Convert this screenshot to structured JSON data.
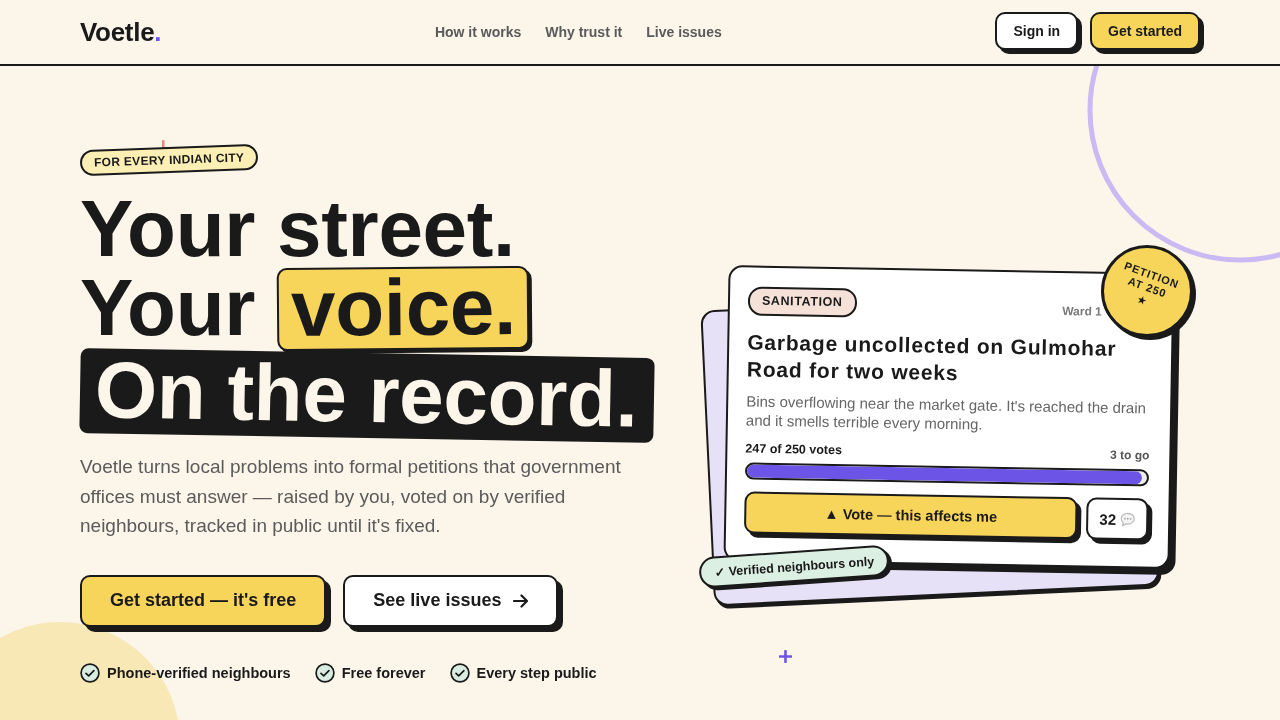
{
  "header": {
    "logo": {
      "name": "Voetle",
      "dot": "."
    },
    "nav": [
      {
        "label": "How it works"
      },
      {
        "label": "Why trust it"
      },
      {
        "label": "Live issues"
      }
    ],
    "buttons": [
      {
        "label": "Sign in",
        "kind": "secondary"
      },
      {
        "label": "Get started",
        "kind": "primary"
      }
    ]
  },
  "hero": {
    "badge": "FOR EVERY INDIAN CITY",
    "headline": [
      [
        {
          "text": "Your street.",
          "kind": "plain"
        }
      ],
      [
        {
          "text": "Your",
          "kind": "plain"
        },
        {
          "text": "voice.",
          "kind": "highlight"
        }
      ],
      [
        {
          "text": "On the record.",
          "kind": "banner"
        }
      ]
    ],
    "description": "Voetle turns local problems into formal petitions that government offices must answer — raised by you, voted on by verified neighbours, tracked in public until it's fixed.",
    "buttons": [
      {
        "label": "Get started — it's free",
        "kind": "primary",
        "arrow": false
      },
      {
        "label": "See live issues",
        "kind": "secondary",
        "arrow": true
      }
    ],
    "features": [
      "Phone-verified neighbours",
      "Free forever",
      "Every step public"
    ]
  },
  "issue_card": {
    "category": "SANITATION",
    "ward": "Ward 1",
    "title": "Garbage uncollected on Gulmohar Road for two weeks",
    "description": "Bins overflowing near the market gate. It's reached the drain and it smells terrible every morning.",
    "votes": "247 of 250 votes",
    "remaining": "3 to go",
    "level": 0.988,
    "vote_button": "▲ Vote — this affects me",
    "comments": "32",
    "stamp": {
      "text": "PETITION AT 250",
      "star": "★"
    },
    "verified_tag": "✓ Verified neighbours only"
  }
}
